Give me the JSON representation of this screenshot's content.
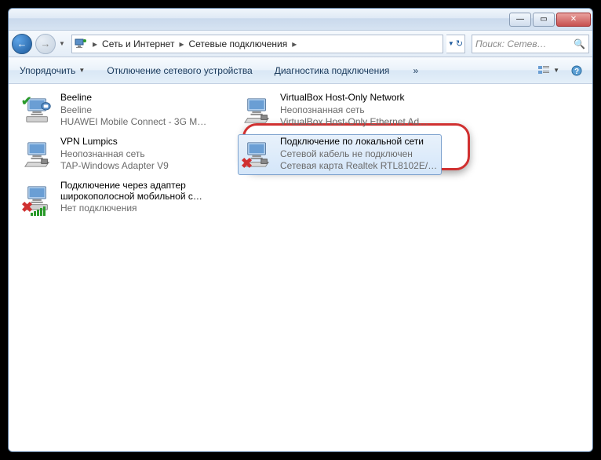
{
  "titlebar": {
    "min": "—",
    "max": "▭",
    "close": "✕"
  },
  "nav": {
    "back": "←",
    "fwd": "→",
    "drop": "▼",
    "refresh": "↻"
  },
  "breadcrumb": {
    "seg1": "Сеть и Интернет",
    "seg2": "Сетевые подключения",
    "arrow": "▸"
  },
  "search": {
    "placeholder": "Поиск: Сетев…",
    "icon": "🔍"
  },
  "toolbar": {
    "organize": "Упорядочить",
    "disable": "Отключение сетевого устройства",
    "diagnose": "Диагностика подключения",
    "more": "»",
    "drop": "▼"
  },
  "connections": [
    {
      "title": "Beeline",
      "sub1": "Beeline",
      "sub2": "HUAWEI Mobile Connect - 3G M…",
      "icon": "wan-ok"
    },
    {
      "title": "VirtualBox Host-Only Network",
      "sub1": "Неопознанная сеть",
      "sub2": "VirtualBox Host-Only Ethernet Ad…",
      "icon": "lan"
    },
    {
      "title": "VPN Lumpics",
      "sub1": "Неопознанная сеть",
      "sub2": "TAP-Windows Adapter V9",
      "icon": "lan"
    },
    {
      "title": "Подключение по локальной сети",
      "sub1": "Сетевой кабель не подключен",
      "sub2": "Сетевая карта Realtek RTL8102E/…",
      "icon": "lan-x",
      "selected": true
    },
    {
      "title": "Подключение через адаптер широкополосной мобильной с…",
      "sub1": "Нет подключения",
      "sub2": "",
      "icon": "wan-x-signal"
    }
  ]
}
